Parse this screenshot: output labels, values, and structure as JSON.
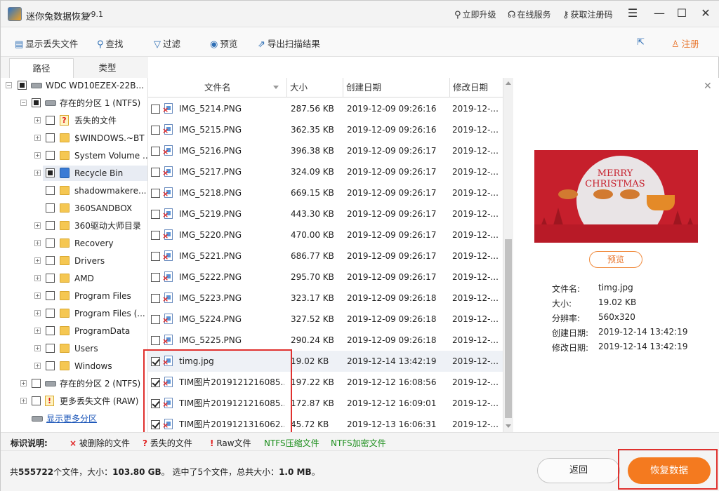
{
  "app": {
    "title": "迷你兔数据恢复",
    "version": "v9.1"
  },
  "title_links": {
    "upgrade": "立即升级",
    "online": "在线服务",
    "register_code": "获取注册码"
  },
  "toolbar": {
    "show_lost": "显示丢失文件",
    "find": "查找",
    "filter": "过滤",
    "preview": "预览",
    "export": "导出扫描结果",
    "register": "注册"
  },
  "tabs": {
    "path": "路径",
    "type": "类型"
  },
  "tree": {
    "disk": "WDC WD10EZEX-22B...",
    "partition1": "存在的分区 1 (NTFS)",
    "items": [
      "丢失的文件",
      "$WINDOWS.~BT",
      "System Volume ...",
      "Recycle Bin",
      "shadowmakere...",
      "360SANDBOX",
      "360驱动大师目录",
      "Recovery",
      "Drivers",
      "AMD",
      "Program Files",
      "Program Files (...",
      "ProgramData",
      "Users",
      "Windows"
    ],
    "partition2": "存在的分区 2 (NTFS)",
    "more_lost": "更多丢失文件 (RAW)",
    "show_more": "显示更多分区"
  },
  "columns": {
    "name": "文件名",
    "size": "大小",
    "created": "创建日期",
    "modified": "修改日期"
  },
  "files": [
    {
      "name": "IMG_5214.PNG",
      "size": "287.56 KB",
      "created": "2019-12-09 09:26:16",
      "modified": "2019-12-...",
      "checked": false
    },
    {
      "name": "IMG_5215.PNG",
      "size": "362.35 KB",
      "created": "2019-12-09 09:26:16",
      "modified": "2019-12-...",
      "checked": false
    },
    {
      "name": "IMG_5216.PNG",
      "size": "396.38 KB",
      "created": "2019-12-09 09:26:17",
      "modified": "2019-12-...",
      "checked": false
    },
    {
      "name": "IMG_5217.PNG",
      "size": "324.09 KB",
      "created": "2019-12-09 09:26:17",
      "modified": "2019-12-...",
      "checked": false
    },
    {
      "name": "IMG_5218.PNG",
      "size": "669.15 KB",
      "created": "2019-12-09 09:26:17",
      "modified": "2019-12-...",
      "checked": false
    },
    {
      "name": "IMG_5219.PNG",
      "size": "443.30 KB",
      "created": "2019-12-09 09:26:17",
      "modified": "2019-12-...",
      "checked": false
    },
    {
      "name": "IMG_5220.PNG",
      "size": "470.00 KB",
      "created": "2019-12-09 09:26:17",
      "modified": "2019-12-...",
      "checked": false
    },
    {
      "name": "IMG_5221.PNG",
      "size": "686.77 KB",
      "created": "2019-12-09 09:26:17",
      "modified": "2019-12-...",
      "checked": false
    },
    {
      "name": "IMG_5222.PNG",
      "size": "295.70 KB",
      "created": "2019-12-09 09:26:17",
      "modified": "2019-12-...",
      "checked": false
    },
    {
      "name": "IMG_5223.PNG",
      "size": "323.17 KB",
      "created": "2019-12-09 09:26:18",
      "modified": "2019-12-...",
      "checked": false
    },
    {
      "name": "IMG_5224.PNG",
      "size": "327.52 KB",
      "created": "2019-12-09 09:26:18",
      "modified": "2019-12-...",
      "checked": false
    },
    {
      "name": "IMG_5225.PNG",
      "size": "290.24 KB",
      "created": "2019-12-09 09:26:18",
      "modified": "2019-12-...",
      "checked": false
    },
    {
      "name": "timg.jpg",
      "size": "19.02 KB",
      "created": "2019-12-14 13:42:19",
      "modified": "2019-12-...",
      "checked": true
    },
    {
      "name": "TIM图片2019121216085...",
      "size": "197.22 KB",
      "created": "2019-12-12 16:08:56",
      "modified": "2019-12-...",
      "checked": true
    },
    {
      "name": "TIM图片2019121216085...",
      "size": "172.87 KB",
      "created": "2019-12-12 16:09:01",
      "modified": "2019-12-...",
      "checked": true
    },
    {
      "name": "TIM图片2019121316062...",
      "size": "45.72 KB",
      "created": "2019-12-13 16:06:31",
      "modified": "2019-12-...",
      "checked": true
    }
  ],
  "preview": {
    "image_text": "MERRY CHRISTMAS",
    "button": "预览",
    "filename_label": "文件名:",
    "filename": "timg.jpg",
    "size_label": "大小:",
    "size": "19.02 KB",
    "res_label": "分辨率:",
    "res": "560x320",
    "created_label": "创建日期:",
    "created": "2019-12-14 13:42:19",
    "modified_label": "修改日期:",
    "modified": "2019-12-14 13:42:19"
  },
  "legend": {
    "title": "标识说明:",
    "deleted": "被删除的文件",
    "lost": "丢失的文件",
    "raw": "Raw文件",
    "ntfs_comp": "NTFS压缩文件",
    "ntfs_enc": "NTFS加密文件"
  },
  "footer": {
    "prefix": "共",
    "count": "555722",
    "mid1": "个文件，大小：",
    "size": "103.80 GB",
    "mid2": "。 选中了5个文件，总共大小：",
    "selsize": "1.0 MB",
    "suffix": "。",
    "back": "返回",
    "recover": "恢复数据"
  },
  "colors": {
    "accent": "#f47a1f",
    "highlight": "#e0312e",
    "link": "#1a55b8",
    "ntfs": "#1e8f1e"
  }
}
